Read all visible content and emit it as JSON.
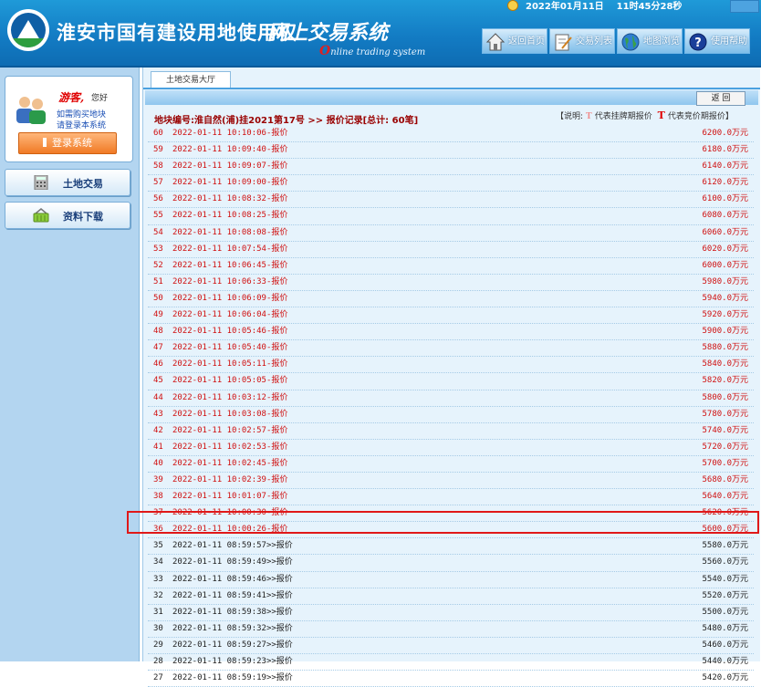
{
  "header": {
    "title_main": "淮安市国有建设用地使用权",
    "title_italic": "网上交易系统",
    "subtitle_cap": "O",
    "subtitle_rest": "nline trading system",
    "date": "2022年01月11日",
    "time": "11时45分28秒"
  },
  "nav": [
    {
      "label": "返回首页",
      "icon": "home-icon"
    },
    {
      "label": "交易列表",
      "icon": "list-edit-icon"
    },
    {
      "label": "地图浏览",
      "icon": "globe-icon"
    },
    {
      "label": "使用帮助",
      "icon": "help-icon"
    }
  ],
  "sidebar": {
    "guest": "游客,",
    "hello": "您好",
    "hint1": "如需购买地块",
    "hint2": "请登录本系统",
    "login": "登录系统",
    "menu": [
      {
        "label": "土地交易",
        "icon": "calculator-icon"
      },
      {
        "label": "资料下载",
        "icon": "basket-icon"
      }
    ]
  },
  "content": {
    "tab": "土地交易大厅",
    "back": "返 回",
    "record_title": "地块编号:淮自然(浦)挂2021第17号 >> 报价记录[总计: 60笔]",
    "legend_prefix": "【说明:",
    "legend_t": "T",
    "legend_1": "代表挂牌期报价",
    "legend_2": "代表竞价期报价】",
    "colors": {
      "red": "#d01010",
      "black": "#222222",
      "accent": "#1780c8"
    }
  },
  "rows": [
    {
      "no": "60",
      "time": "2022-01-11 10:10:06-报价",
      "price": "6200.0万元",
      "phase": "red"
    },
    {
      "no": "59",
      "time": "2022-01-11 10:09:40-报价",
      "price": "6180.0万元",
      "phase": "red"
    },
    {
      "no": "58",
      "time": "2022-01-11 10:09:07-报价",
      "price": "6140.0万元",
      "phase": "red"
    },
    {
      "no": "57",
      "time": "2022-01-11 10:09:00-报价",
      "price": "6120.0万元",
      "phase": "red"
    },
    {
      "no": "56",
      "time": "2022-01-11 10:08:32-报价",
      "price": "6100.0万元",
      "phase": "red"
    },
    {
      "no": "55",
      "time": "2022-01-11 10:08:25-报价",
      "price": "6080.0万元",
      "phase": "red"
    },
    {
      "no": "54",
      "time": "2022-01-11 10:08:08-报价",
      "price": "6060.0万元",
      "phase": "red"
    },
    {
      "no": "53",
      "time": "2022-01-11 10:07:54-报价",
      "price": "6020.0万元",
      "phase": "red"
    },
    {
      "no": "52",
      "time": "2022-01-11 10:06:45-报价",
      "price": "6000.0万元",
      "phase": "red"
    },
    {
      "no": "51",
      "time": "2022-01-11 10:06:33-报价",
      "price": "5980.0万元",
      "phase": "red"
    },
    {
      "no": "50",
      "time": "2022-01-11 10:06:09-报价",
      "price": "5940.0万元",
      "phase": "red"
    },
    {
      "no": "49",
      "time": "2022-01-11 10:06:04-报价",
      "price": "5920.0万元",
      "phase": "red"
    },
    {
      "no": "48",
      "time": "2022-01-11 10:05:46-报价",
      "price": "5900.0万元",
      "phase": "red"
    },
    {
      "no": "47",
      "time": "2022-01-11 10:05:40-报价",
      "price": "5880.0万元",
      "phase": "red"
    },
    {
      "no": "46",
      "time": "2022-01-11 10:05:11-报价",
      "price": "5840.0万元",
      "phase": "red"
    },
    {
      "no": "45",
      "time": "2022-01-11 10:05:05-报价",
      "price": "5820.0万元",
      "phase": "red"
    },
    {
      "no": "44",
      "time": "2022-01-11 10:03:12-报价",
      "price": "5800.0万元",
      "phase": "red"
    },
    {
      "no": "43",
      "time": "2022-01-11 10:03:08-报价",
      "price": "5780.0万元",
      "phase": "red"
    },
    {
      "no": "42",
      "time": "2022-01-11 10:02:57-报价",
      "price": "5740.0万元",
      "phase": "red"
    },
    {
      "no": "41",
      "time": "2022-01-11 10:02:53-报价",
      "price": "5720.0万元",
      "phase": "red"
    },
    {
      "no": "40",
      "time": "2022-01-11 10:02:45-报价",
      "price": "5700.0万元",
      "phase": "red"
    },
    {
      "no": "39",
      "time": "2022-01-11 10:02:39-报价",
      "price": "5680.0万元",
      "phase": "red"
    },
    {
      "no": "38",
      "time": "2022-01-11 10:01:07-报价",
      "price": "5640.0万元",
      "phase": "red"
    },
    {
      "no": "37",
      "time": "2022-01-11 10:00:30-报价",
      "price": "5620.0万元",
      "phase": "red"
    },
    {
      "no": "36",
      "time": "2022-01-11 10:00:26-报价",
      "price": "5600.0万元",
      "phase": "red"
    },
    {
      "no": "35",
      "time": "2022-01-11 08:59:57>>报价",
      "price": "5580.0万元",
      "phase": "black"
    },
    {
      "no": "34",
      "time": "2022-01-11 08:59:49>>报价",
      "price": "5560.0万元",
      "phase": "black"
    },
    {
      "no": "33",
      "time": "2022-01-11 08:59:46>>报价",
      "price": "5540.0万元",
      "phase": "black"
    },
    {
      "no": "32",
      "time": "2022-01-11 08:59:41>>报价",
      "price": "5520.0万元",
      "phase": "black"
    },
    {
      "no": "31",
      "time": "2022-01-11 08:59:38>>报价",
      "price": "5500.0万元",
      "phase": "black"
    },
    {
      "no": "30",
      "time": "2022-01-11 08:59:32>>报价",
      "price": "5480.0万元",
      "phase": "black"
    },
    {
      "no": "29",
      "time": "2022-01-11 08:59:27>>报价",
      "price": "5460.0万元",
      "phase": "black"
    },
    {
      "no": "28",
      "time": "2022-01-11 08:59:23>>报价",
      "price": "5440.0万元",
      "phase": "black"
    },
    {
      "no": "27",
      "time": "2022-01-11 08:59:19>>报价",
      "price": "5420.0万元",
      "phase": "black"
    }
  ]
}
